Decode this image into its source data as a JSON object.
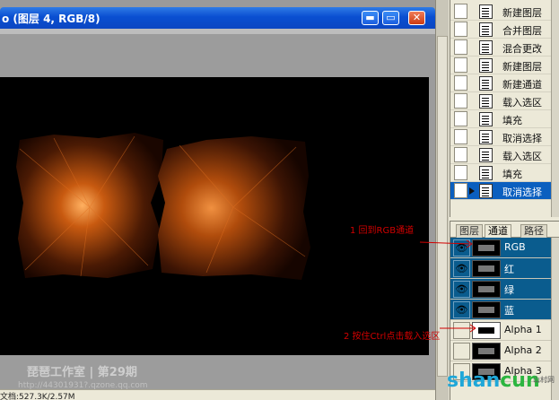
{
  "document": {
    "title": "o (图层 4, RGB/8)",
    "window_buttons": {
      "minimize": "▬",
      "maximize": "▭",
      "close": "✕"
    },
    "status": "文档:527.3K/2.57M",
    "watermark": "琵琶工作室 | 第29期",
    "watermark_sub": "http://44301931?.qzone.qq.com"
  },
  "history": {
    "items": [
      {
        "label": "新建图层"
      },
      {
        "label": "合并图层"
      },
      {
        "label": "混合更改"
      },
      {
        "label": "新建图层"
      },
      {
        "label": "新建通道"
      },
      {
        "label": "载入选区"
      },
      {
        "label": "填充"
      },
      {
        "label": "取消选择"
      },
      {
        "label": "载入选区"
      },
      {
        "label": "填充"
      },
      {
        "label": "取消选择"
      }
    ],
    "selected_index": 10
  },
  "channels_panel": {
    "tabs": [
      "图层",
      "通道",
      "路径"
    ],
    "active_tab": "通道",
    "eye_icon": "👁",
    "channels": [
      {
        "name": "RGB",
        "visible": true,
        "selected": true
      },
      {
        "name": "红",
        "visible": true,
        "selected": true
      },
      {
        "name": "绿",
        "visible": true,
        "selected": true
      },
      {
        "name": "蓝",
        "visible": true,
        "selected": true
      },
      {
        "name": "Alpha 1",
        "visible": false,
        "selected": false
      },
      {
        "name": "Alpha 2",
        "visible": false,
        "selected": false
      },
      {
        "name": "Alpha 3",
        "visible": false,
        "selected": false
      }
    ]
  },
  "annotations": [
    {
      "text": "1 回到RGB通道"
    },
    {
      "text": "2 按住Ctrl点击载入选区"
    }
  ],
  "site_logo": {
    "part1": "shan",
    "part2": "cun",
    "suffix": "山村网"
  },
  "colors": {
    "annotation": "#d10000",
    "selection": "#0a5c8e",
    "titlebar": "#0a4fd1",
    "glow": "#c85a10"
  }
}
